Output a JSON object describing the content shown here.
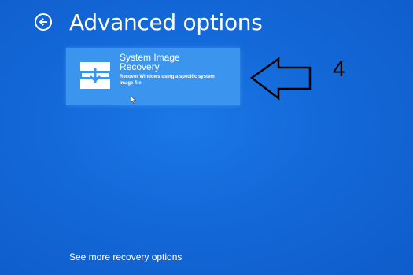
{
  "colors": {
    "background": "#1468d8",
    "tile_background": "#3b95ee",
    "text": "#ffffff",
    "annotation": "#000000"
  },
  "header": {
    "back_icon": "back-arrow-circle-icon",
    "title": "Advanced options"
  },
  "options": [
    {
      "icon": "system-image-recovery-icon",
      "title": "System Image Recovery",
      "description": "Recover Windows using a specific system image file"
    }
  ],
  "annotation": {
    "arrow": "left-pointing-arrow-outline",
    "step_number": "4"
  },
  "footer": {
    "more_options_link": "See more recovery options"
  }
}
